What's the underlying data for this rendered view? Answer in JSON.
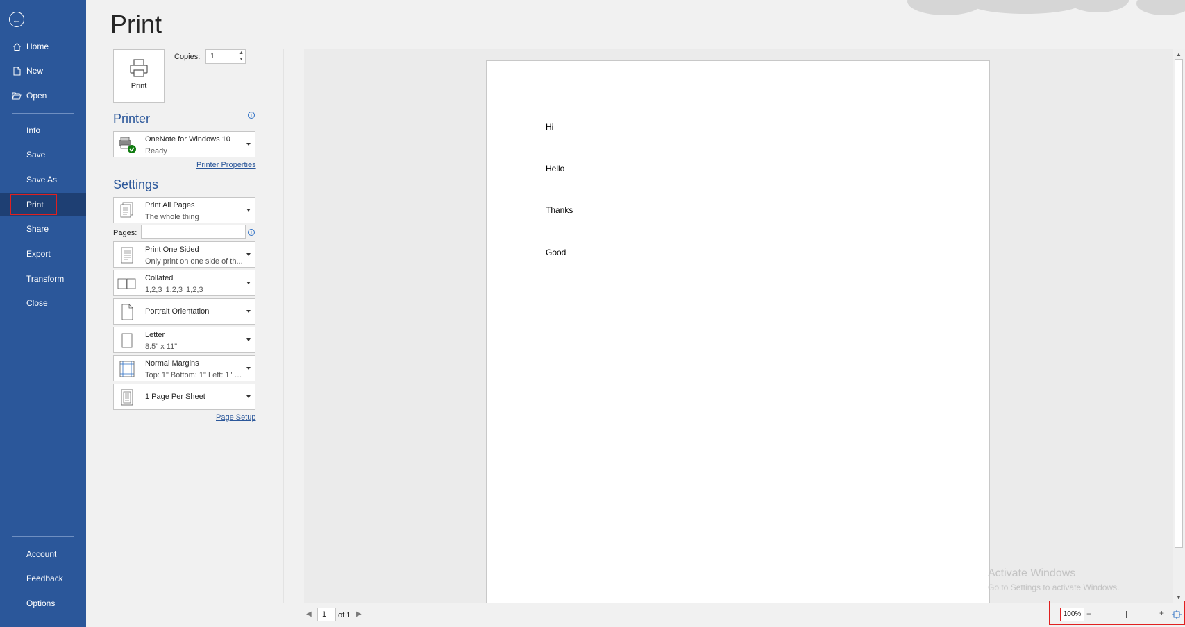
{
  "sidebar": {
    "back_icon": "back-arrow-icon",
    "items": [
      {
        "label": "Home",
        "icon": "home-icon"
      },
      {
        "label": "New",
        "icon": "new-document-icon"
      },
      {
        "label": "Open",
        "icon": "folder-open-icon"
      },
      {
        "label": "Info"
      },
      {
        "label": "Save"
      },
      {
        "label": "Save As"
      },
      {
        "label": "Print",
        "selected": true
      },
      {
        "label": "Share"
      },
      {
        "label": "Export"
      },
      {
        "label": "Transform"
      },
      {
        "label": "Close"
      }
    ],
    "bottom": [
      {
        "label": "Account"
      },
      {
        "label": "Feedback"
      },
      {
        "label": "Options"
      }
    ]
  },
  "page_title": "Print",
  "print_button": {
    "label": "Print"
  },
  "copies": {
    "label": "Copies:",
    "value": "1"
  },
  "printer": {
    "heading": "Printer",
    "name": "OneNote for Windows 10",
    "status": "Ready",
    "properties_link": "Printer Properties"
  },
  "settings": {
    "heading": "Settings",
    "pages_label": "Pages:",
    "pages_value": "",
    "options": [
      {
        "line1": "Print All Pages",
        "line2": "The whole thing"
      },
      {
        "line1": "Print One Sided",
        "line2": "Only print on one side of th..."
      },
      {
        "line1": "Collated",
        "line2": "1,2,3    1,2,3    1,2,3"
      },
      {
        "line1": "Portrait Orientation"
      },
      {
        "line1": "Letter",
        "line2": "8.5\" x 11\""
      },
      {
        "line1": "Normal Margins",
        "line2": "Top: 1\" Bottom: 1\" Left: 1\" Ri..."
      },
      {
        "line1": "1 Page Per Sheet"
      }
    ],
    "page_setup_link": "Page Setup"
  },
  "preview": {
    "lines": [
      "Hi",
      "Hello",
      "Thanks",
      "Good"
    ]
  },
  "watermark": {
    "title": "Activate Windows",
    "subtitle": "Go to Settings to activate Windows."
  },
  "pager": {
    "current": "1",
    "of_label": "of 1"
  },
  "zoom": {
    "percent": "100%",
    "minus": "−",
    "plus": "+",
    "slider_position": 0.5
  },
  "colors": {
    "sidebar": "#2b579a",
    "selected": "#1e3f73",
    "highlight": "#e02020"
  }
}
